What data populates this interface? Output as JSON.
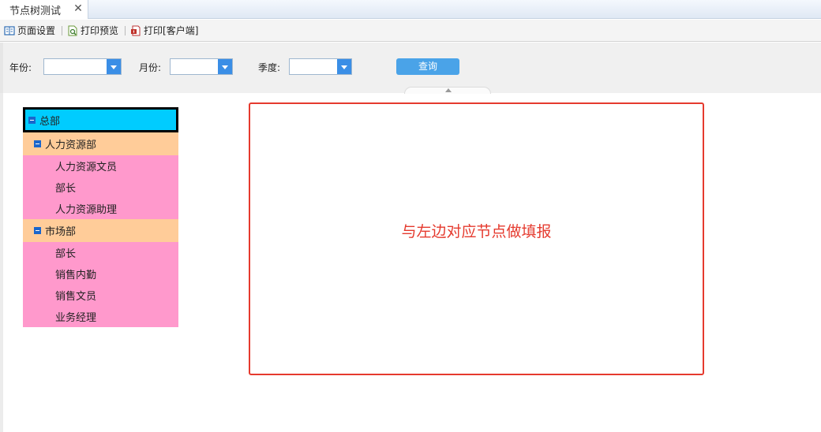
{
  "tab": {
    "title": "节点树测试",
    "close_glyph": "✕"
  },
  "toolbar": {
    "items": [
      {
        "label": "页面设置",
        "icon": "page-setup-icon"
      },
      {
        "label": "打印预览",
        "icon": "print-preview-icon"
      },
      {
        "label": "打印[客户端]",
        "icon": "print-client-icon"
      }
    ]
  },
  "params": {
    "year_label": "年份:",
    "month_label": "月份:",
    "quarter_label": "季度:",
    "year_value": "",
    "month_value": "",
    "quarter_value": "",
    "query_label": "查询"
  },
  "tree": {
    "root": "总部",
    "departments": [
      {
        "name": "人力资源部",
        "children": [
          "人力资源文员",
          "部长",
          "人力资源助理"
        ]
      },
      {
        "name": "市场部",
        "children": [
          "部长",
          "销售内勤",
          "销售文员",
          "业务经理"
        ]
      }
    ]
  },
  "panel": {
    "text": "与左边对应节点做填报"
  },
  "colors": {
    "root_bg": "#00ccff",
    "dept_bg": "#ffcc99",
    "leaf_bg": "#ff99cc",
    "panel_border": "#e53a2e",
    "query_btn": "#4aa3e8"
  }
}
